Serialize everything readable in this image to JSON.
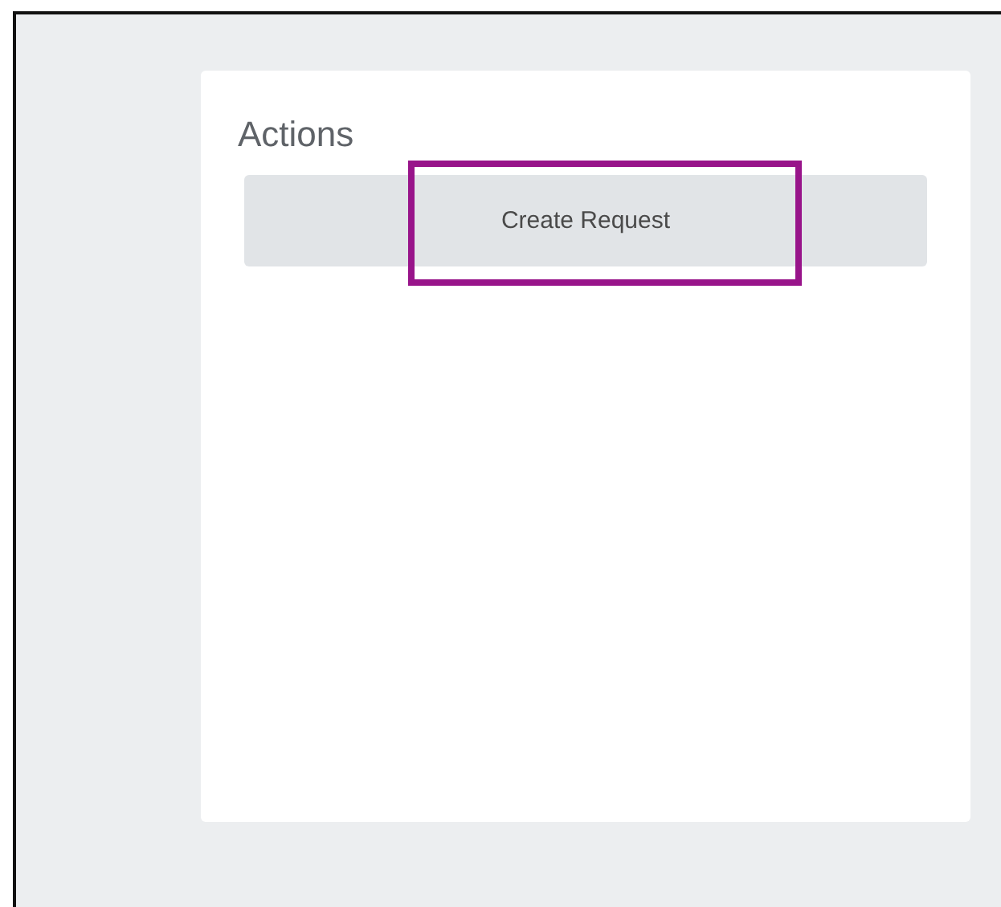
{
  "card": {
    "title": "Actions",
    "buttons": [
      {
        "label": "Create Request",
        "highlighted": true
      }
    ]
  }
}
